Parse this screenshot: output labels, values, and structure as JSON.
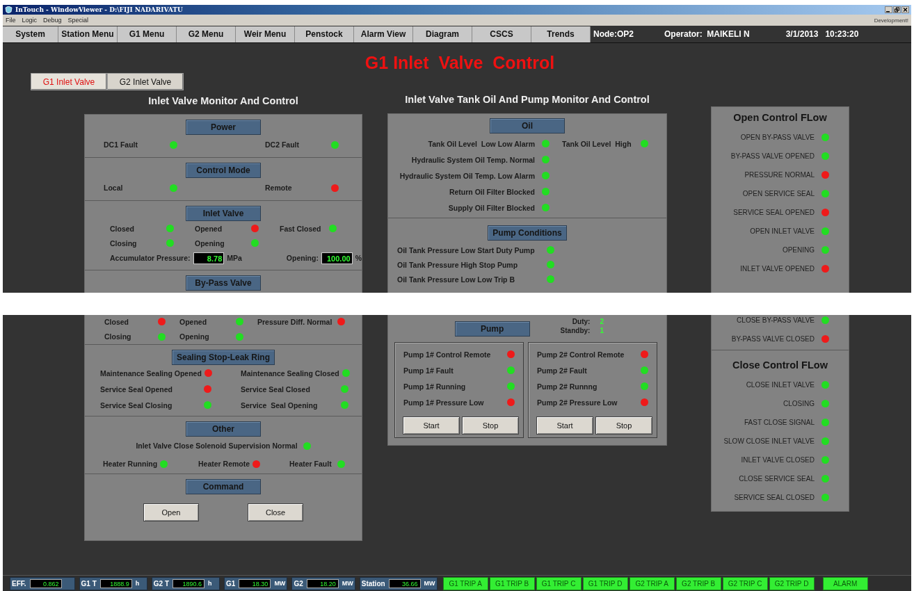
{
  "window": {
    "title": "InTouch - WindowViewer - D:\\FIJI NADARIVATU"
  },
  "menu": [
    "File",
    "Logic",
    "Debug",
    "Special"
  ],
  "mode_label": "Development!",
  "nav": [
    "System",
    "Station Menu",
    "G1 Menu",
    "G2 Menu",
    "Weir Menu",
    "Penstock",
    "Alarm View",
    "Diagram",
    "CSCS",
    "Trends"
  ],
  "node": "Node:OP2",
  "operator": "Operator:  MAIKELI N",
  "datetime": "3/1/2013   10:23:20",
  "page_title": "G1 Inlet  Valve  Control",
  "tabs": [
    {
      "label": "G1 Inlet Valve",
      "selected": true
    },
    {
      "label": "G2 Inlet Valve",
      "selected": false
    }
  ],
  "left_panel": {
    "title": "Inlet Valve Monitor And Control",
    "sections": [
      {
        "header": "Power",
        "kind": "pair",
        "rows": [
          {
            "kind": "indicators",
            "items": [
              {
                "label": "DC1 Fault",
                "color": "#22dd22"
              },
              {
                "label": "DC2 Fault",
                "color": "#22dd22"
              }
            ]
          }
        ]
      },
      {
        "header": "Control Mode",
        "kind": "pair",
        "rows": [
          {
            "kind": "indicators",
            "items": [
              {
                "label": "Local",
                "color": "#22dd22"
              },
              {
                "label": "Remote",
                "color": "#ee1a1a"
              }
            ]
          }
        ]
      },
      {
        "header": "Inlet Valve",
        "kind": "valve",
        "rows": [
          {
            "kind": "indicators",
            "items": [
              {
                "label": "Closed",
                "color": "#22dd22"
              },
              {
                "label": "Opened",
                "color": "#ee1a1a"
              },
              {
                "label": "Fast Closed",
                "color": "#22dd22"
              }
            ]
          },
          {
            "kind": "indicators",
            "items": [
              {
                "label": "Closing",
                "color": "#22dd22"
              },
              {
                "label": "Opening",
                "color": "#22dd22"
              }
            ]
          },
          {
            "kind": "readouts",
            "items": [
              {
                "label": "Accumulator Pressure:",
                "value": "8.78",
                "unit": "MPa"
              },
              {
                "label": "Opening:",
                "value": "100.00",
                "unit": "%"
              }
            ]
          }
        ]
      },
      {
        "header": "By-Pass Valve",
        "kind": "bypass",
        "rows": [
          {
            "kind": "indicators",
            "items": [
              {
                "label": "Closed",
                "color": "#ee1a1a"
              },
              {
                "label": "Opened",
                "color": "#22dd22"
              },
              {
                "label": "Pressure Diff. Normal",
                "color": "#ee1a1a"
              }
            ]
          },
          {
            "kind": "indicators",
            "items": [
              {
                "label": "Closing",
                "color": "#22dd22"
              },
              {
                "label": "Opening",
                "color": "#22dd22"
              }
            ]
          }
        ]
      },
      {
        "header": "Sealing  Stop-Leak Ring",
        "kind": "double",
        "rows": [
          {
            "kind": "indicators",
            "items": [
              {
                "label": "Maintenance Sealing Opened",
                "color": "#ee1a1a"
              },
              {
                "label": "Maintenance Sealing Closed",
                "color": "#22dd22"
              }
            ]
          },
          {
            "kind": "indicators",
            "items": [
              {
                "label": "Service Seal Opened",
                "color": "#ee1a1a"
              },
              {
                "label": "Service Seal Closed",
                "color": "#22dd22"
              }
            ]
          },
          {
            "kind": "indicators",
            "items": [
              {
                "label": "Service Seal Closing",
                "color": "#22dd22"
              },
              {
                "label": "Service  Seal Opening",
                "color": "#22dd22"
              }
            ]
          }
        ]
      },
      {
        "header": "Other",
        "kind": "other",
        "rows": [
          {
            "kind": "centered",
            "items": [
              {
                "label": "Inlet Valve Close Solenoid Supervision Normal",
                "color": "#22dd22"
              }
            ]
          },
          {
            "kind": "indicators",
            "items": [
              {
                "label": "Heater Running",
                "color": "#22dd22"
              },
              {
                "label": "Heater Remote",
                "color": "#ee1a1a"
              },
              {
                "label": "Heater Fault",
                "color": "#22dd22"
              }
            ]
          }
        ]
      },
      {
        "header": "Command",
        "kind": "command",
        "rows": [
          {
            "kind": "buttons",
            "items": [
              "Open",
              "Close"
            ]
          }
        ]
      }
    ]
  },
  "middle_panel": {
    "title": "Inlet Valve Tank Oil And Pump Monitor And Control",
    "sections": [
      {
        "header": "Oil",
        "kind": "oil",
        "rows": [
          [
            {
              "label": "Tank Oil Level  Low Low Alarm",
              "color": "#22dd22"
            },
            {
              "label": "Tank Oil Level  High",
              "color": "#22dd22"
            }
          ],
          [
            {
              "label": "Hydraulic System Oil Temp. Normal",
              "color": "#22dd22"
            }
          ],
          [
            {
              "label": "Hydraulic System Oil Temp. Low Alarm",
              "color": "#22dd22"
            }
          ],
          [
            {
              "label": "Return Oil Filter Blocked",
              "color": "#22dd22"
            }
          ],
          [
            {
              "label": "Supply Oil Filter Blocked",
              "color": "#22dd22"
            }
          ]
        ]
      },
      {
        "header": "Pump Conditions",
        "kind": "list",
        "rows": [
          [
            {
              "label": "Oil Tank Pressure Low Start Duty Pump",
              "color": "#22dd22"
            }
          ],
          [
            {
              "label": "Oil Tank Pressure High Stop Pump",
              "color": "#22dd22"
            }
          ],
          [
            {
              "label": "Oil Tank Pressure Low Low Trip B",
              "color": "#22dd22"
            }
          ]
        ]
      },
      {
        "header": "Pump",
        "kind": "pumps",
        "duty": {
          "label": "Duty:",
          "value": "2"
        },
        "standby": {
          "label": "Standby:",
          "value": "1"
        },
        "pumps": [
          {
            "indicators": [
              {
                "label": "Pump 1# Control Remote",
                "color": "#ee1a1a"
              },
              {
                "label": "Pump 1# Fault",
                "color": "#22dd22"
              },
              {
                "label": "Pump 1# Running",
                "color": "#22dd22"
              },
              {
                "label": "Pump 1# Pressure Low",
                "color": "#ee1a1a"
              }
            ],
            "buttons": [
              "Start",
              "Stop"
            ]
          },
          {
            "indicators": [
              {
                "label": "Pump 2# Control Remote",
                "color": "#ee1a1a"
              },
              {
                "label": "Pump 2# Fault",
                "color": "#22dd22"
              },
              {
                "label": "Pump 2# Runnng",
                "color": "#22dd22"
              },
              {
                "label": "Pump 2# Pressure Low",
                "color": "#ee1a1a"
              }
            ],
            "buttons": [
              "Start",
              "Stop"
            ]
          }
        ]
      }
    ]
  },
  "right_panel": {
    "sections": [
      {
        "title": "Open Control FLow",
        "items": [
          {
            "label": "OPEN BY-PASS VALVE",
            "color": "#22dd22"
          },
          {
            "label": "BY-PASS VALVE OPENED",
            "color": "#22dd22"
          },
          {
            "label": "PRESSURE NORMAL",
            "color": "#ee1a1a"
          },
          {
            "label": "OPEN SERVICE SEAL",
            "color": "#22dd22"
          },
          {
            "label": "SERVICE SEAL OPENED",
            "color": "#ee1a1a"
          },
          {
            "label": "OPEN INLET VALVE",
            "color": "#22dd22"
          },
          {
            "label": "OPENING",
            "color": "#22dd22"
          },
          {
            "label": "INLET VALVE OPENED",
            "color": "#ee1a1a"
          },
          {
            "label": "CLOSE BY-PASS VALVE",
            "color": "#22dd22"
          },
          {
            "label": "BY-PASS VALVE CLOSED",
            "color": "#ee1a1a"
          }
        ]
      },
      {
        "title": "Close Control FLow",
        "items": [
          {
            "label": "CLOSE INLET VALVE",
            "color": "#22dd22"
          },
          {
            "label": "CLOSING",
            "color": "#22dd22"
          },
          {
            "label": "FAST CLOSE SIGNAL",
            "color": "#22dd22"
          },
          {
            "label": "SLOW CLOSE INLET VALVE",
            "color": "#22dd22"
          },
          {
            "label": "INLET VALVE CLOSED",
            "color": "#22dd22"
          },
          {
            "label": "CLOSE SERVICE SEAL",
            "color": "#22dd22"
          },
          {
            "label": "SERVICE SEAL CLOSED",
            "color": "#22dd22"
          }
        ]
      }
    ]
  },
  "status_bar": {
    "readouts": [
      {
        "label": "EFF.",
        "value": "0.862"
      },
      {
        "label": "G1 T",
        "value": "1888.9",
        "unit": "h"
      },
      {
        "label": "G2 T",
        "value": "1890.6",
        "unit": "h"
      },
      {
        "label": "G1",
        "value": "18.30",
        "unit": "MW"
      },
      {
        "label": "G2",
        "value": "18.20",
        "unit": "MW"
      },
      {
        "label": "Station",
        "value": "36.66",
        "unit": "MW"
      }
    ],
    "trips": [
      "G1 TRIP A",
      "G1 TRIP B",
      "G1 TRIP C",
      "G1 TRIP D",
      "G2 TRIP A",
      "G2 TRIP B",
      "G2 TRIP C",
      "G2 TRIP D"
    ],
    "alarm": "ALARM"
  }
}
